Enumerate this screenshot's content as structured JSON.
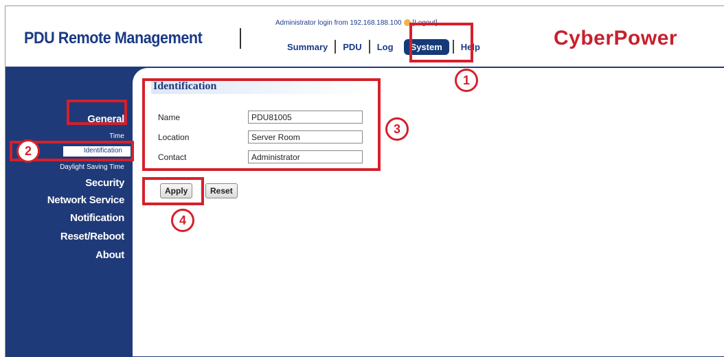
{
  "header": {
    "app_title": "PDU Remote Management",
    "login_prefix": "Administrator login from 192.168.188.100",
    "logout_label": "[Logout]",
    "logo_text": "CyberPower"
  },
  "nav": {
    "summary": "Summary",
    "pdu": "PDU",
    "log": "Log",
    "system": "System",
    "help": "Help",
    "active": "System"
  },
  "sidebar": {
    "general": "General",
    "time": "Time",
    "identification": "Identification",
    "daylight_saving_time": "Daylight Saving Time",
    "security": "Security",
    "network_service": "Network Service",
    "notification": "Notification",
    "reset_reboot": "Reset/Reboot",
    "about": "About",
    "active": "Identification"
  },
  "main": {
    "section_title": "Identification",
    "fields": {
      "name_label": "Name",
      "name_value": "PDU81005",
      "location_label": "Location",
      "location_value": "Server Room",
      "contact_label": "Contact",
      "contact_value": "Administrator"
    },
    "apply_label": "Apply",
    "reset_label": "Reset"
  },
  "annotations": {
    "badge_1": "1",
    "badge_2": "2",
    "badge_3": "3",
    "badge_4": "4",
    "color": "#d5202b"
  },
  "colors": {
    "brand_blue": "#1f3a78",
    "logo_red": "#c8202e"
  }
}
